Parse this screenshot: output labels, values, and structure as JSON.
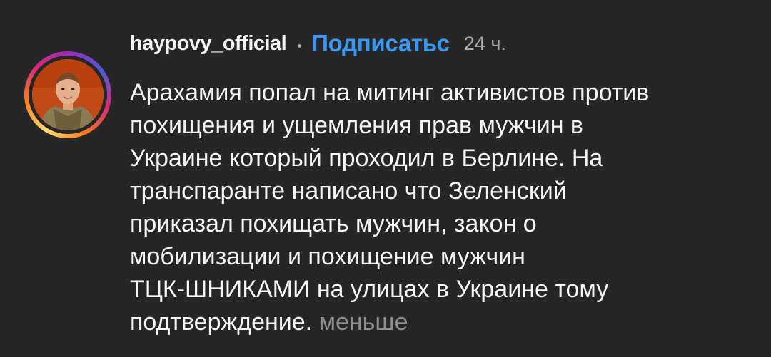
{
  "post": {
    "username": "haypovy_official",
    "follow_label": "Подписатьс",
    "time": "24 ч.",
    "comment_text": "Арахамия попал на митинг активистов против\nпохищения и ущемления прав мужчин в\nУкраине который проходил в Берлине. На\nтранспаранте написано что Зеленский\nприказал похищать мужчин, закон о\nмобилизации и похищение мужчин\nТЦК-ШНИКАМИ на улицах в Украине тому\nподтверждение.",
    "less_label": "меньше"
  },
  "colors": {
    "background": "#262626",
    "text": "#f5f5f5",
    "link": "#3897f0",
    "muted": "#a8a8a8"
  }
}
